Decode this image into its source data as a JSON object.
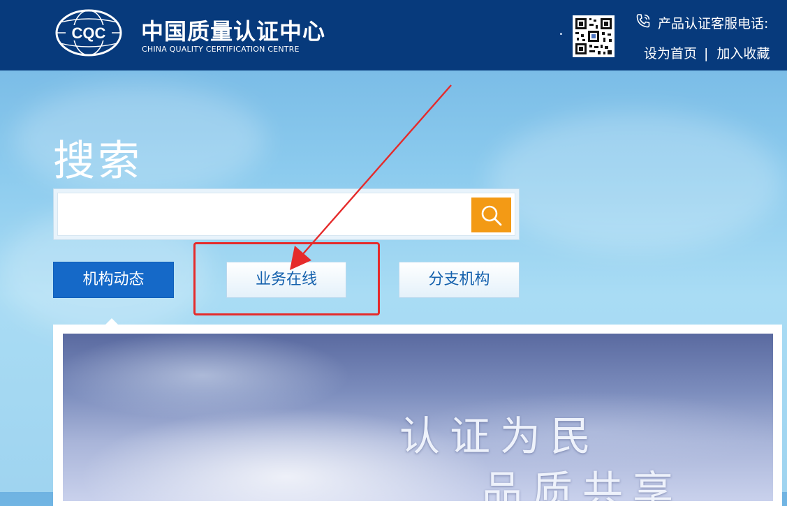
{
  "header": {
    "logo_text": "CQC",
    "org_name_cn": "中国质量认证中心",
    "org_name_en": "CHINA QUALITY CERTIFICATION CENTRE",
    "hotline_label": "产品认证客服电话:",
    "set_homepage": "设为首页",
    "separator": "|",
    "add_favorite": "加入收藏"
  },
  "search": {
    "title": "搜索",
    "placeholder": "",
    "value": ""
  },
  "tabs": [
    {
      "label": "机构动态",
      "active": true
    },
    {
      "label": "业务在线",
      "active": false,
      "highlighted": true
    },
    {
      "label": "分支机构",
      "active": false
    }
  ],
  "banner": {
    "line1": "认证为民",
    "line2": "品质共享"
  },
  "colors": {
    "header_bg": "#073a7c",
    "active_tab": "#1569c8",
    "search_button": "#f39a15",
    "annotation": "#e52b2b"
  },
  "icons": {
    "search": "magnifier-icon",
    "phone": "phone-icon",
    "qr": "qr-code-icon",
    "annotation_arrow": "red-arrow-icon"
  }
}
